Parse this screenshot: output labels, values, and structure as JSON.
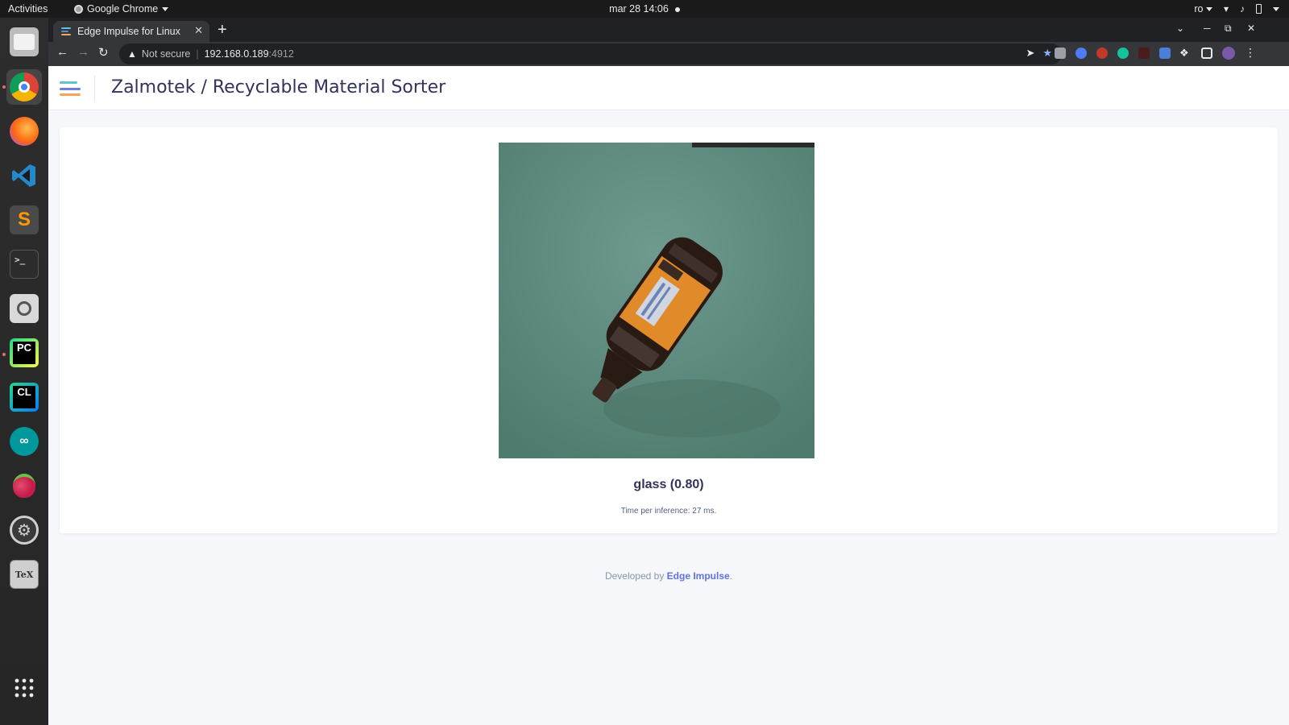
{
  "topbar": {
    "activities": "Activities",
    "app_name": "Google Chrome",
    "clock": "mar 28  14:06",
    "keyboard_layout": "ro"
  },
  "dock": {
    "items": [
      {
        "name": "files",
        "icon": "folder-icon"
      },
      {
        "name": "chrome",
        "icon": "chrome-icon",
        "active": true
      },
      {
        "name": "firefox",
        "icon": "firefox-icon"
      },
      {
        "name": "vscode",
        "icon": "vscode-icon"
      },
      {
        "name": "sublime",
        "icon": "sublime-icon"
      },
      {
        "name": "terminal",
        "icon": "terminal-icon"
      },
      {
        "name": "search",
        "icon": "magnifier-icon"
      },
      {
        "name": "pycharm",
        "icon": "pycharm-icon"
      },
      {
        "name": "clion",
        "icon": "clion-icon"
      },
      {
        "name": "arduino",
        "icon": "arduino-icon"
      },
      {
        "name": "raspberry",
        "icon": "raspberry-icon"
      },
      {
        "name": "settings",
        "icon": "gear-icon"
      },
      {
        "name": "texmaker",
        "icon": "texmaker-icon"
      }
    ],
    "apps_grid_icon": "grid-icon"
  },
  "browser": {
    "tab_title": "Edge Impulse for Linux",
    "security_label": "Not secure",
    "url_host": "192.168.0.189",
    "url_port": ":4912"
  },
  "page": {
    "title": "Zalmotek / Recyclable Material Sorter",
    "classification": "glass (0.80)",
    "timing": "Time per inference: 27 ms.",
    "footer_prefix": "Developed by ",
    "footer_link": "Edge Impulse",
    "footer_suffix": "."
  },
  "colors": {
    "accent": "#5e72e4",
    "title": "#32325d",
    "background": "#f5f7fb"
  }
}
